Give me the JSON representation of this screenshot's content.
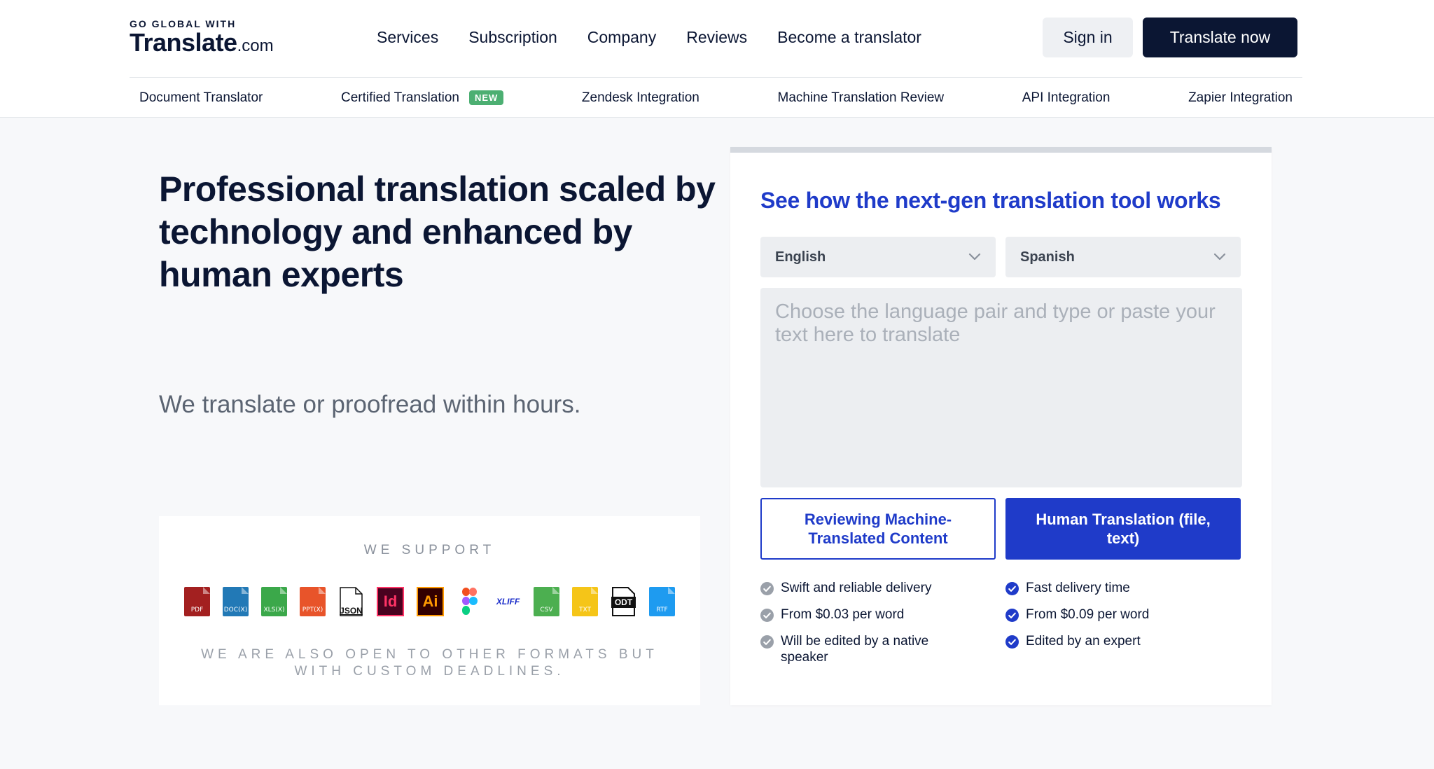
{
  "header": {
    "logo_small": "GO GLOBAL WITH",
    "logo_word": "Translate",
    "logo_tld": ".com",
    "nav": [
      "Services",
      "Subscription",
      "Company",
      "Reviews",
      "Become a translator"
    ],
    "signin_label": "Sign in",
    "cta_label": "Translate now"
  },
  "subnav": {
    "items": [
      "Document Translator",
      "Certified Translation",
      "Zendesk Integration",
      "Machine Translation Review",
      "API Integration",
      "Zapier Integration"
    ],
    "new_badge": "NEW"
  },
  "hero": {
    "title": "Professional translation scaled by technology and enhanced by human experts",
    "subtitle": "We translate or proofread within hours."
  },
  "support": {
    "title": "WE SUPPORT",
    "formats": [
      {
        "icon": "pdf-file-icon",
        "label": "PDF",
        "color": "#a32020"
      },
      {
        "icon": "docx-file-icon",
        "label": "DOC(X)",
        "color": "#2279b6"
      },
      {
        "icon": "xlsx-file-icon",
        "label": "XLS(X)",
        "color": "#3ba84a"
      },
      {
        "icon": "pptx-file-icon",
        "label": "PPT(X)",
        "color": "#e8542a"
      },
      {
        "icon": "json-file-icon",
        "label": "JSON",
        "color": "#111111"
      },
      {
        "icon": "indesign-icon",
        "label": "Id",
        "color": "#ff3366"
      },
      {
        "icon": "illustrator-icon",
        "label": "Ai",
        "color": "#ff9a00"
      },
      {
        "icon": "figma-icon",
        "label": "",
        "color": "#a259ff"
      },
      {
        "icon": "xliff-icon",
        "label": "XLIFF",
        "color": "#1a2cc9"
      },
      {
        "icon": "csv-file-icon",
        "label": "CSV",
        "color": "#4caf50"
      },
      {
        "icon": "txt-file-icon",
        "label": "TXT",
        "color": "#f5c518"
      },
      {
        "icon": "odt-file-icon",
        "label": "ODT",
        "color": "#111111"
      },
      {
        "icon": "rtf-file-icon",
        "label": "RTF",
        "color": "#1e9bf0"
      }
    ],
    "note": "WE ARE ALSO OPEN TO OTHER FORMATS BUT WITH CUSTOM DEADLINES."
  },
  "tool": {
    "title": "See how the next-gen translation tool works",
    "source_lang": "English",
    "target_lang": "Spanish",
    "placeholder": "Choose the language pair and type or paste your text here to translate",
    "option_review": "Reviewing Machine-Translated Content",
    "option_human": "Human Translation (file, text)",
    "review_features": [
      "Swift and reliable delivery",
      "From $0.03 per word",
      "Will be edited by a native speaker"
    ],
    "human_features": [
      "Fast delivery time",
      "From $0.09 per word",
      "Edited by an expert"
    ]
  },
  "colors": {
    "navy": "#0b1633",
    "accent_blue": "#1f3bc9",
    "new_badge": "#4caf72",
    "grey_check": "#9aa0a9"
  }
}
